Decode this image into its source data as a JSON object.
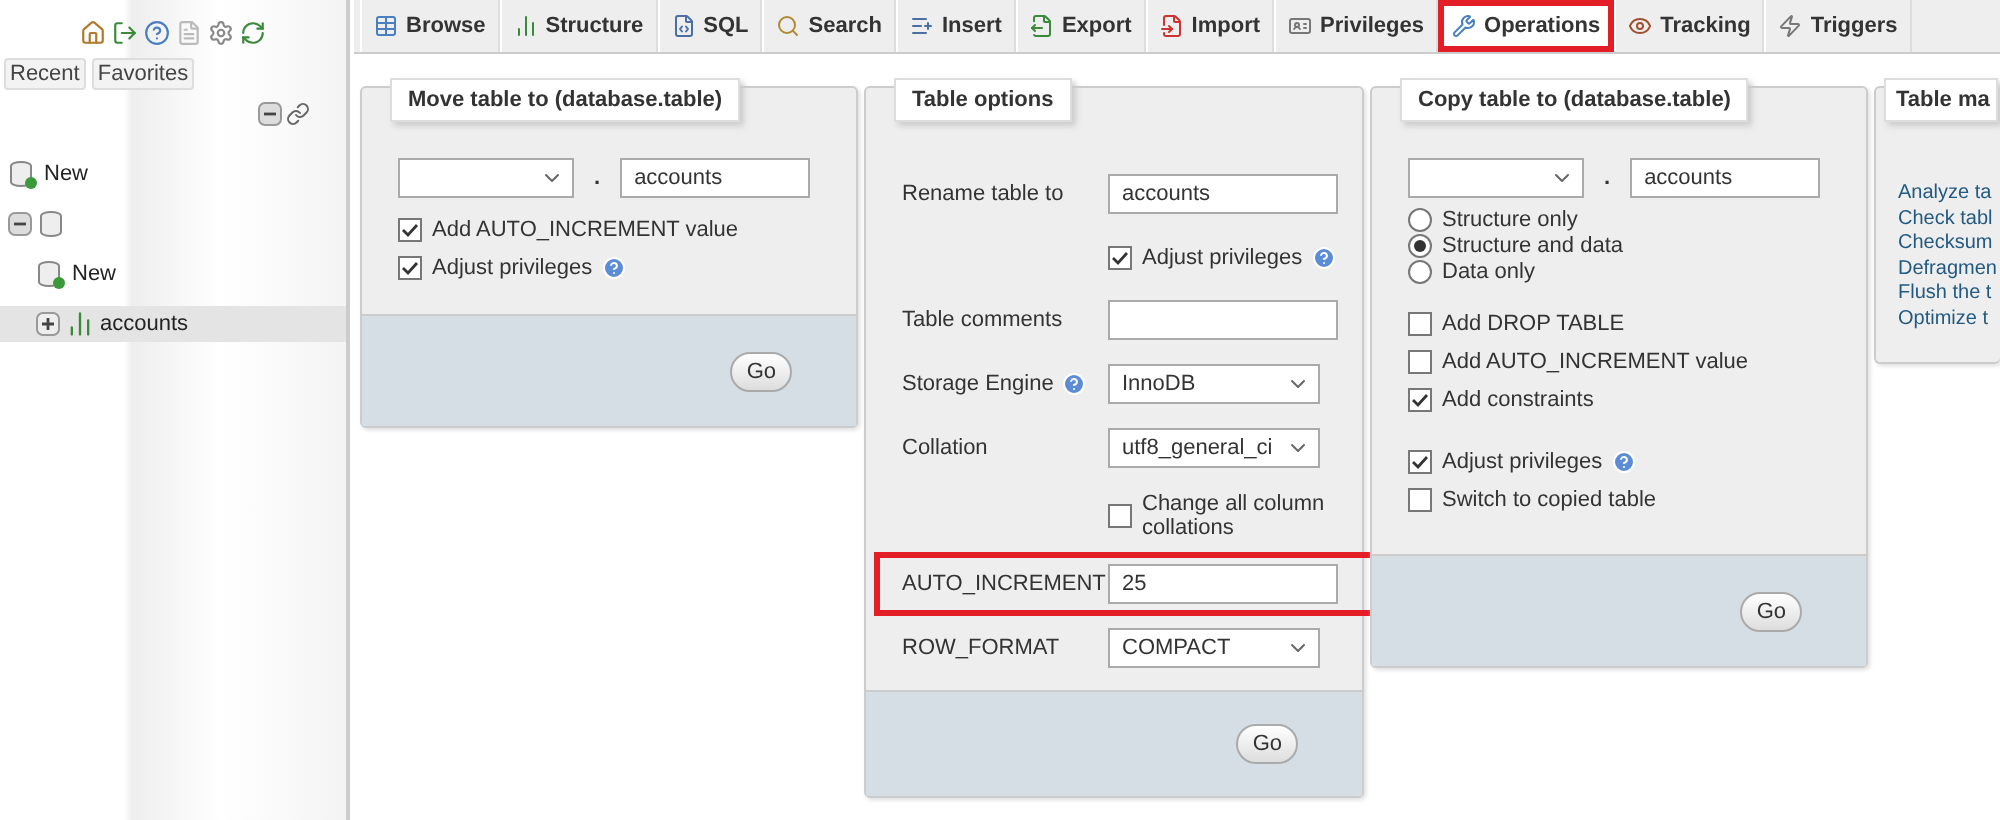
{
  "sidebar": {
    "tabs": [
      {
        "label": "Recent"
      },
      {
        "label": "Favorites"
      }
    ],
    "tree": [
      {
        "kind": "new",
        "label": "New",
        "selected": false
      },
      {
        "kind": "database",
        "expanded": true,
        "selected": false,
        "children": [
          {
            "kind": "new",
            "label": "New",
            "selected": false
          },
          {
            "kind": "table",
            "label": "accounts",
            "expanded": false,
            "selected": true
          }
        ]
      }
    ]
  },
  "tabs": [
    {
      "label": "Browse",
      "selected": false,
      "highlighted": false
    },
    {
      "label": "Structure",
      "selected": false,
      "highlighted": false
    },
    {
      "label": "SQL",
      "selected": false,
      "highlighted": false
    },
    {
      "label": "Search",
      "selected": false,
      "highlighted": false
    },
    {
      "label": "Insert",
      "selected": false,
      "highlighted": false
    },
    {
      "label": "Export",
      "selected": false,
      "highlighted": false
    },
    {
      "label": "Import",
      "selected": false,
      "highlighted": false
    },
    {
      "label": "Privileges",
      "selected": false,
      "highlighted": false
    },
    {
      "label": "Operations",
      "selected": true,
      "highlighted": true
    },
    {
      "label": "Tracking",
      "selected": false,
      "highlighted": false
    },
    {
      "label": "Triggers",
      "selected": false,
      "highlighted": false
    }
  ],
  "move_table": {
    "title": "Move table to (database.table)",
    "separator": ".",
    "table_name": "accounts",
    "options": [
      {
        "label": "Add AUTO_INCREMENT value",
        "checked": true
      },
      {
        "label": "Adjust privileges",
        "checked": true,
        "help": true
      }
    ],
    "button": "Go"
  },
  "table_options": {
    "title": "Table options",
    "rows": [
      {
        "kind": "input",
        "label": "Rename table to",
        "value": "accounts",
        "highlighted": false
      },
      {
        "kind": "check",
        "label": "Adjust privileges",
        "checked": true,
        "help": true
      },
      {
        "kind": "input",
        "label": "Table comments",
        "highlighted": false
      },
      {
        "kind": "select",
        "label": "Storage Engine",
        "help": true,
        "value": "InnoDB"
      },
      {
        "kind": "select",
        "label": "Collation",
        "value": "utf8_general_ci"
      },
      {
        "kind": "check",
        "label": "Change all column collations",
        "checked": false
      },
      {
        "kind": "input",
        "label": "AUTO_INCREMENT",
        "value": "25",
        "highlighted": true
      },
      {
        "kind": "select",
        "label": "ROW_FORMAT",
        "value": "COMPACT"
      }
    ],
    "button": "Go"
  },
  "copy_table": {
    "title": "Copy table to (database.table)",
    "separator": ".",
    "table_name": "accounts",
    "modes": [
      {
        "label": "Structure only",
        "selected": false
      },
      {
        "label": "Structure and data",
        "selected": true
      },
      {
        "label": "Data only",
        "selected": false
      }
    ],
    "options": [
      {
        "label": "Add DROP TABLE",
        "checked": false
      },
      {
        "label": "Add AUTO_INCREMENT value",
        "checked": false
      },
      {
        "label": "Add constraints",
        "checked": true
      }
    ],
    "options_2": [
      {
        "label": "Adjust privileges",
        "checked": true,
        "help": true
      },
      {
        "label": "Switch to copied table",
        "checked": false
      }
    ],
    "button": "Go"
  },
  "maintenance": {
    "title": "Table ma",
    "links": [
      "Analyze ta",
      "Check tabl",
      "Checksum",
      "Defragmen",
      "Flush the t",
      "Optimize t"
    ]
  }
}
